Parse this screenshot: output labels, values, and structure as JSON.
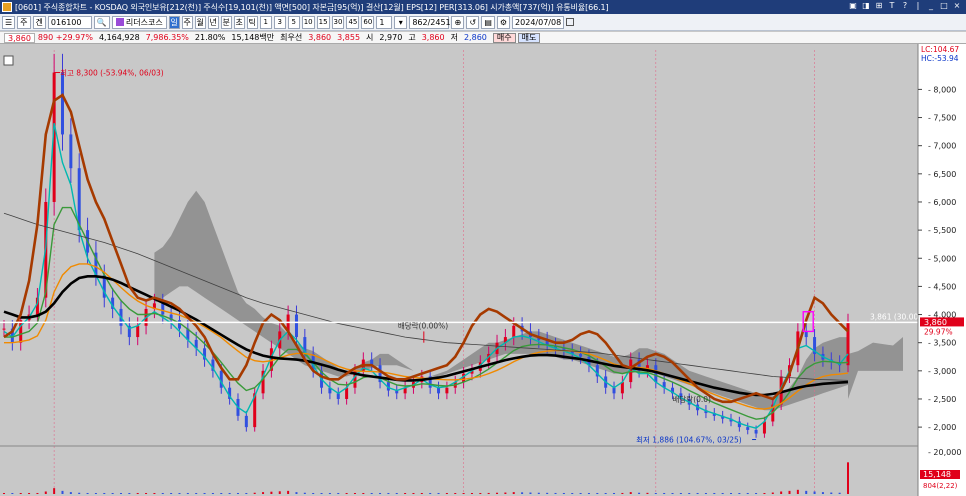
{
  "title_bar": {
    "text": "[0601] 주식종합차트 - KOSDAQ 외국인보유[212(천)] 주식수[19,101(천)] 액면[500] 자본금[95(억)] 결산[12월] EPS[12] PER[313.06] 시가총액[737(억)] 유통비율[66.1]",
    "controls": [
      "▣",
      "◨",
      "⊞",
      "T",
      "?",
      "|",
      "_",
      "□",
      "×"
    ]
  },
  "toolbar": {
    "menu_btn": "☰",
    "menu2_btn": "주",
    "type_select": "겐",
    "stock_code": "016100",
    "search_icon": "🔍",
    "stock_name": "리더스코스",
    "periods": [
      "일",
      "주",
      "월",
      "년",
      "분",
      "초",
      "틱"
    ],
    "active_period": "일",
    "intervals": [
      "1",
      "3",
      "5",
      "10",
      "15",
      "30",
      "45",
      "60"
    ],
    "unit_value": "1",
    "count_display": "862/2451",
    "date": "2024/07/08"
  },
  "quote_bar": {
    "price": "3,860",
    "change": "890 +29.97%",
    "volume": "4,164,928",
    "volume_ratio": "7,986.35%",
    "turnover": "21.80%",
    "amount": "15,148백만",
    "best_label": "최우선",
    "best_ask": "3,860",
    "best_bid": "3,855",
    "open_label": "시",
    "open": "2,970",
    "high_label": "고",
    "high": "3,860",
    "low_label": "저",
    "low": "2,860",
    "buy_label": "매수",
    "sell_label": "매도"
  },
  "chart_data": {
    "type": "line",
    "y_axis": {
      "ticks": [
        "8,000",
        "7,500",
        "7,000",
        "6,500",
        "6,000",
        "5,500",
        "5,000",
        "4,500",
        "4,000",
        "3,500",
        "3,000",
        "2,500",
        "2,000"
      ],
      "tick_values": [
        8000,
        7500,
        7000,
        6500,
        6000,
        5500,
        5000,
        4500,
        4000,
        3500,
        3000,
        2500,
        2000
      ],
      "range": [
        1700,
        8700
      ],
      "lc_label": "LC:104.67",
      "hc_label": "HC:-53.94",
      "current_price_label": "3,860",
      "current_pct_label": "29.97%"
    },
    "volume_axis": {
      "ticks": [
        "20,000"
      ],
      "tick_values": [
        20000
      ],
      "current_label": "15,148",
      "current_label2": "804(2,22)"
    },
    "annotations": {
      "high": "최고 8,300 (-53.94%, 06/03)",
      "low": "최저 1,886 (104.67%, 03/25)",
      "dividend": "배당락(0.00%)",
      "ref_line": "3,861 (30.00%)",
      "dividend2": "배당락(0.0)"
    },
    "ref_line_value": 3861,
    "price_series": [
      {
        "name": "close",
        "color": "#d4006a",
        "values": [
          3750,
          3500,
          3900,
          4000,
          4300,
          6000,
          8300,
          7200,
          6600,
          5500,
          5100,
          4700,
          4300,
          4100,
          3800,
          3600,
          3800,
          4100,
          4200,
          4000,
          3900,
          3750,
          3550,
          3400,
          3200,
          3000,
          2700,
          2500,
          2200,
          2000,
          2600,
          3000,
          3400,
          3700,
          4000,
          3600,
          3300,
          3000,
          2700,
          2600,
          2500,
          2700,
          3000,
          3200,
          3100,
          2800,
          2650,
          2600,
          2700,
          2800,
          2900,
          2700,
          2600,
          2700,
          2800,
          2950,
          3000,
          3150,
          3300,
          3500,
          3600,
          3800,
          3700,
          3600,
          3550,
          3450,
          3400,
          3350,
          3300,
          3250,
          3100,
          2900,
          2700,
          2600,
          2800,
          3200,
          3000,
          3100,
          2800,
          2700,
          2600,
          2500,
          2400,
          2300,
          2250,
          2200,
          2150,
          2100,
          2000,
          1950,
          1886,
          2100,
          2400,
          2900,
          3100,
          3700,
          3600,
          3300,
          3200,
          3150,
          3100,
          3860
        ]
      }
    ],
    "moving_averages": [
      {
        "name": "ma5",
        "color": "#00b8b0",
        "values": [
          3700,
          3600,
          3800,
          3950,
          4200,
          5200,
          7400,
          6700,
          6300,
          5500,
          5000,
          4700,
          4400,
          4150,
          3950,
          3750,
          3800,
          3950,
          4050,
          3950,
          3850,
          3700,
          3550,
          3400,
          3250,
          3050,
          2800,
          2550,
          2350,
          2250,
          2550,
          2900,
          3250,
          3550,
          3700,
          3550,
          3350,
          3100,
          2850,
          2700,
          2600,
          2700,
          2900,
          3050,
          3000,
          2850,
          2700,
          2650,
          2700,
          2750,
          2850,
          2750,
          2700,
          2720,
          2800,
          2900,
          3000,
          3100,
          3250,
          3400,
          3500,
          3600,
          3620,
          3580,
          3520,
          3450,
          3400,
          3350,
          3300,
          3220,
          3100,
          2950,
          2800,
          2700,
          2800,
          3050,
          2950,
          2950,
          2800,
          2700,
          2620,
          2520,
          2440,
          2360,
          2290,
          2240,
          2190,
          2140,
          2070,
          2020,
          1980,
          2100,
          2350,
          2700,
          3000,
          3400,
          3450,
          3350,
          3250,
          3180,
          3120,
          3300
        ]
      },
      {
        "name": "ma20",
        "color": "#3a9a3a",
        "values": [
          3600,
          3600,
          3650,
          3700,
          3850,
          4400,
          5600,
          5900,
          5900,
          5600,
          5300,
          5000,
          4700,
          4450,
          4250,
          4100,
          4000,
          4000,
          4020,
          3980,
          3920,
          3850,
          3740,
          3620,
          3480,
          3330,
          3150,
          2960,
          2780,
          2650,
          2700,
          2850,
          3050,
          3250,
          3380,
          3380,
          3300,
          3150,
          2980,
          2850,
          2760,
          2750,
          2800,
          2880,
          2910,
          2880,
          2810,
          2750,
          2730,
          2740,
          2770,
          2760,
          2740,
          2730,
          2750,
          2800,
          2860,
          2940,
          3030,
          3140,
          3250,
          3360,
          3430,
          3460,
          3470,
          3460,
          3440,
          3410,
          3380,
          3330,
          3270,
          3180,
          3080,
          2980,
          2950,
          2990,
          2980,
          2970,
          2920,
          2860,
          2800,
          2730,
          2650,
          2580,
          2500,
          2430,
          2370,
          2310,
          2250,
          2190,
          2140,
          2160,
          2260,
          2420,
          2620,
          2870,
          3040,
          3130,
          3170,
          3160,
          3140,
          3150
        ]
      },
      {
        "name": "ma60",
        "color": "#f08a00",
        "values": [
          3500,
          3500,
          3520,
          3550,
          3620,
          3900,
          4400,
          4700,
          4850,
          4900,
          4900,
          4850,
          4750,
          4620,
          4480,
          4350,
          4240,
          4160,
          4110,
          4070,
          4030,
          3990,
          3930,
          3860,
          3780,
          3690,
          3590,
          3470,
          3350,
          3240,
          3180,
          3160,
          3180,
          3230,
          3280,
          3310,
          3310,
          3280,
          3220,
          3150,
          3080,
          3030,
          3000,
          2990,
          2990,
          2980,
          2960,
          2930,
          2900,
          2880,
          2870,
          2860,
          2850,
          2840,
          2840,
          2850,
          2870,
          2900,
          2950,
          3010,
          3080,
          3160,
          3230,
          3290,
          3330,
          3350,
          3360,
          3360,
          3350,
          3330,
          3300,
          3250,
          3190,
          3120,
          3080,
          3070,
          3060,
          3040,
          3000,
          2950,
          2890,
          2830,
          2770,
          2700,
          2640,
          2580,
          2520,
          2470,
          2420,
          2370,
          2330,
          2320,
          2350,
          2420,
          2520,
          2640,
          2750,
          2840,
          2900,
          2930,
          2940,
          2960
        ]
      },
      {
        "name": "ma120",
        "color": "#000000",
        "values": [
          4050,
          4000,
          3950,
          3950,
          3980,
          4050,
          4200,
          4400,
          4550,
          4650,
          4680,
          4680,
          4660,
          4620,
          4560,
          4490,
          4420,
          4350,
          4280,
          4210,
          4140,
          4070,
          3990,
          3910,
          3820,
          3730,
          3640,
          3550,
          3460,
          3380,
          3320,
          3270,
          3240,
          3220,
          3210,
          3200,
          3180,
          3150,
          3110,
          3070,
          3020,
          2980,
          2950,
          2920,
          2900,
          2880,
          2860,
          2840,
          2830,
          2830,
          2840,
          2860,
          2880,
          2910,
          2950,
          2990,
          3030,
          3070,
          3110,
          3150,
          3190,
          3220,
          3250,
          3270,
          3280,
          3280,
          3270,
          3250,
          3230,
          3210,
          3180,
          3150,
          3120,
          3090,
          3070,
          3050,
          3030,
          3010,
          2980,
          2940,
          2900,
          2860,
          2820,
          2780,
          2740,
          2700,
          2670,
          2640,
          2610,
          2590,
          2570,
          2570,
          2590,
          2620,
          2660,
          2700,
          2730,
          2750,
          2770,
          2780,
          2790,
          2800
        ]
      },
      {
        "name": "ma240",
        "color": "#404040",
        "values": [
          5800,
          5750,
          5700,
          5650,
          5600,
          5560,
          5520,
          5480,
          5440,
          5400,
          5360,
          5320,
          5280,
          5230,
          5180,
          5130,
          5080,
          5020,
          4960,
          4900,
          4840,
          4780,
          4720,
          4660,
          4600,
          4540,
          4480,
          4420,
          4360,
          4300,
          4250,
          4200,
          4160,
          4120,
          4080,
          4040,
          4000,
          3960,
          3920,
          3880,
          3840,
          3810,
          3780,
          3750,
          3720,
          3690,
          3660,
          3630,
          3600,
          3580,
          3560,
          3540,
          3520,
          3500,
          3490,
          3480,
          3470,
          3460,
          3450,
          3440,
          3430,
          3420,
          3410,
          3400,
          3390,
          3380,
          3370,
          3360,
          3350,
          3340,
          3330,
          3320,
          3300,
          3280,
          3260,
          3240,
          3220,
          3200,
          3180,
          3160,
          3140,
          3120,
          3100,
          3080,
          3060,
          3040,
          3020,
          3000,
          2980,
          2960,
          2940,
          2920,
          2900,
          2890,
          2880,
          2870,
          2860,
          2850,
          2845,
          2840,
          2835,
          2830
        ]
      },
      {
        "name": "envelope",
        "color": "#a63a00",
        "values": [
          3600,
          3700,
          4000,
          4600,
          5600,
          7200,
          7800,
          7900,
          7600,
          7000,
          6400,
          6000,
          5700,
          5300,
          4900,
          4500,
          4300,
          4250,
          4300,
          4250,
          4200,
          4100,
          3950,
          3800,
          3600,
          3300,
          3050,
          2850,
          2850,
          3100,
          3500,
          3850,
          4000,
          3900,
          3700,
          3450,
          3200,
          3000,
          2900,
          2850,
          2850,
          2950,
          3050,
          3100,
          3100,
          3000,
          2900,
          2850,
          2850,
          2900,
          2950,
          3000,
          3050,
          3100,
          3250,
          3500,
          3800,
          4000,
          4100,
          4050,
          3950,
          3850,
          3750,
          3650,
          3600,
          3550,
          3500,
          3500,
          3550,
          3650,
          3700,
          3650,
          3500,
          3300,
          3100,
          3050,
          3150,
          3250,
          3300,
          3250,
          3150,
          3000,
          2850,
          2700,
          2600,
          2500,
          2450,
          2450,
          2500,
          2550,
          2600,
          2550,
          2500,
          2650,
          2950,
          3400,
          3900,
          4300,
          4200,
          4000,
          3850,
          3700
        ]
      }
    ],
    "cloud_upper": [
      null,
      null,
      null,
      null,
      null,
      null,
      null,
      null,
      null,
      null,
      null,
      null,
      null,
      null,
      null,
      null,
      null,
      null,
      5100,
      5200,
      5400,
      5700,
      6000,
      6200,
      6000,
      5600,
      5200,
      4800,
      4400,
      4200,
      4100,
      3950,
      3850,
      3800,
      3650,
      3500,
      3400,
      3350,
      3250,
      3150,
      3050,
      3000,
      3050,
      3150,
      3200,
      3300,
      3300,
      3200,
      3100,
      3000,
      2950,
      2900,
      2950,
      3000,
      3100,
      3200,
      3300,
      3400,
      3500,
      3500,
      3550,
      3600,
      3650,
      3700,
      3700,
      3650,
      3600,
      3550,
      3500,
      3450,
      3400,
      3350,
      3300,
      3250,
      3250,
      3300,
      3400,
      3400,
      3350,
      3300,
      3200,
      3100,
      3000,
      2950,
      2900,
      2850,
      2800,
      2750,
      2700,
      2650,
      2600,
      2550,
      2550,
      2600,
      2700,
      2900,
      3200,
      3400,
      3500,
      3550,
      3600,
      3600
    ],
    "cloud_lower": [
      null,
      null,
      null,
      null,
      null,
      null,
      null,
      null,
      null,
      null,
      null,
      null,
      null,
      null,
      null,
      null,
      null,
      null,
      4200,
      4300,
      4400,
      4500,
      4500,
      4400,
      4300,
      4200,
      4100,
      4000,
      3900,
      3800,
      3700,
      3600,
      3500,
      3400,
      3300,
      3200,
      3100,
      3050,
      3000,
      2950,
      2900,
      2900,
      2950,
      3000,
      3050,
      3100,
      3100,
      3100,
      3050,
      3000,
      2950,
      2900,
      2900,
      2950,
      3000,
      3050,
      3100,
      3150,
      3200,
      3250,
      3300,
      3300,
      3300,
      3300,
      3300,
      3300,
      3250,
      3200,
      3200,
      3150,
      3100,
      3050,
      3000,
      2950,
      2950,
      2950,
      3000,
      3000,
      2950,
      2900,
      2850,
      2800,
      2750,
      2700,
      2650,
      2600,
      2550,
      2500,
      2450,
      2400,
      2350,
      2300,
      2300,
      2350,
      2400,
      2450,
      2500,
      2550,
      2600,
      2650,
      2700,
      2750
    ],
    "volume": [
      300,
      200,
      150,
      200,
      350,
      1200,
      2800,
      1500,
      900,
      600,
      400,
      350,
      300,
      250,
      200,
      180,
      250,
      400,
      450,
      300,
      250,
      200,
      180,
      160,
      150,
      140,
      200,
      250,
      300,
      280,
      600,
      900,
      1100,
      1300,
      1500,
      900,
      600,
      400,
      350,
      300,
      280,
      300,
      350,
      400,
      350,
      300,
      280,
      260,
      280,
      300,
      320,
      300,
      280,
      300,
      320,
      350,
      400,
      450,
      500,
      600,
      700,
      900,
      800,
      700,
      600,
      550,
      500,
      480,
      450,
      420,
      400,
      380,
      350,
      330,
      500,
      900,
      600,
      550,
      450,
      400,
      380,
      350,
      330,
      300,
      280,
      260,
      250,
      240,
      230,
      220,
      210,
      400,
      700,
      1200,
      1500,
      2000,
      1500,
      1200,
      900,
      700,
      600,
      15148
    ]
  },
  "colors": {
    "up": "#e0001a",
    "down": "#0a35c8",
    "chart_bg": "#c8c8c8",
    "title_bar": "#1f3d7a"
  }
}
